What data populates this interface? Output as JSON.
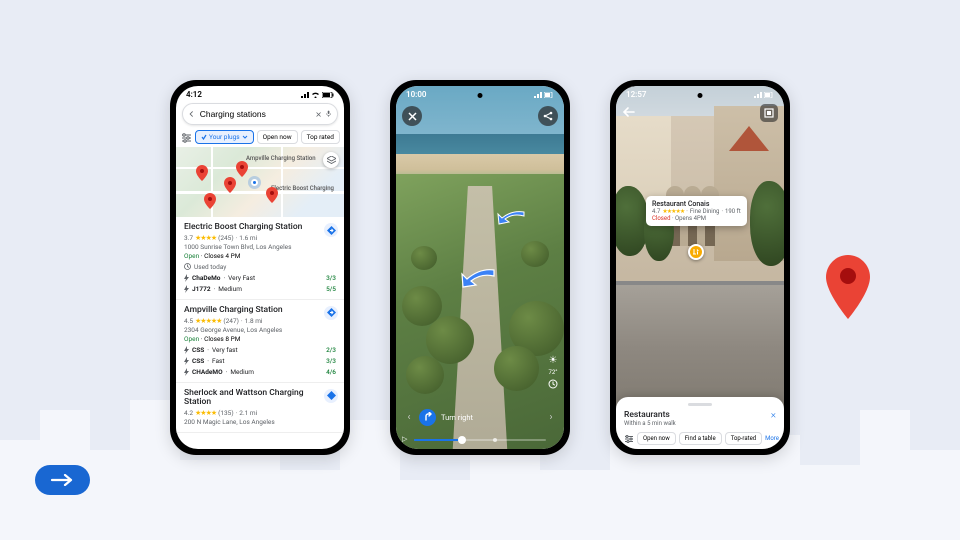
{
  "phone1": {
    "time": "4:12",
    "search_value": "Charging stations",
    "chips": {
      "your_plugs": "Your plugs",
      "open_now": "Open now",
      "top_rated": "Top rated"
    },
    "map_labels": {
      "amp": "Ampville Charging Station",
      "eb": "Electric Boost Charging"
    },
    "results": [
      {
        "title": "Electric Boost Charging Station",
        "rating": "3.7",
        "stars": "★★★★",
        "reviews": "(245)",
        "distance": "1.6 mi",
        "address": "1000 Sunrise Town Blvd, Los Angeles",
        "status_open": "Open",
        "status_rest": " · Closes 4 PM",
        "used": "Used today",
        "plugs": [
          {
            "name": "ChaDeMo",
            "speed": "Very Fast",
            "avail": "3/3"
          },
          {
            "name": "J1772",
            "speed": "Medium",
            "avail": "5/5"
          }
        ]
      },
      {
        "title": "Ampville Charging Station",
        "rating": "4.5",
        "stars": "★★★★★",
        "reviews": "(247)",
        "distance": "1.8 mi",
        "address": "2304 George Avenue, Los Angeles",
        "status_open": "Open",
        "status_rest": " · Closes 8 PM",
        "plugs": [
          {
            "name": "CSS",
            "speed": "Very fast",
            "avail": "2/3"
          },
          {
            "name": "CSS",
            "speed": "Fast",
            "avail": "3/3"
          },
          {
            "name": "CHAdeMO",
            "speed": "Medium",
            "avail": "4/6"
          }
        ]
      },
      {
        "title": "Sherlock and Wattson Charging Station",
        "rating": "4.2",
        "stars": "★★★★",
        "reviews": "(135)",
        "distance": "2.1 mi",
        "address": "200 N Magic Lane, Los Angeles"
      }
    ]
  },
  "phone2": {
    "time": "10:00",
    "direction": "Turn right",
    "temp": "72°"
  },
  "phone3": {
    "time": "12:57",
    "poi": {
      "name": "Restaurant Conais",
      "rating": "4.7",
      "stars": "★★★★★",
      "type": "Fine Dining",
      "dist": "190 ft",
      "status_closed": "Closed",
      "status_rest": " · Opens 4PM"
    },
    "sheet": {
      "title": "Restaurants",
      "subtitle": "Within a 5 min walk",
      "chips": {
        "open_now": "Open now",
        "find_table": "Find a table",
        "top_rated": "Top-rated"
      },
      "more": "More"
    }
  }
}
